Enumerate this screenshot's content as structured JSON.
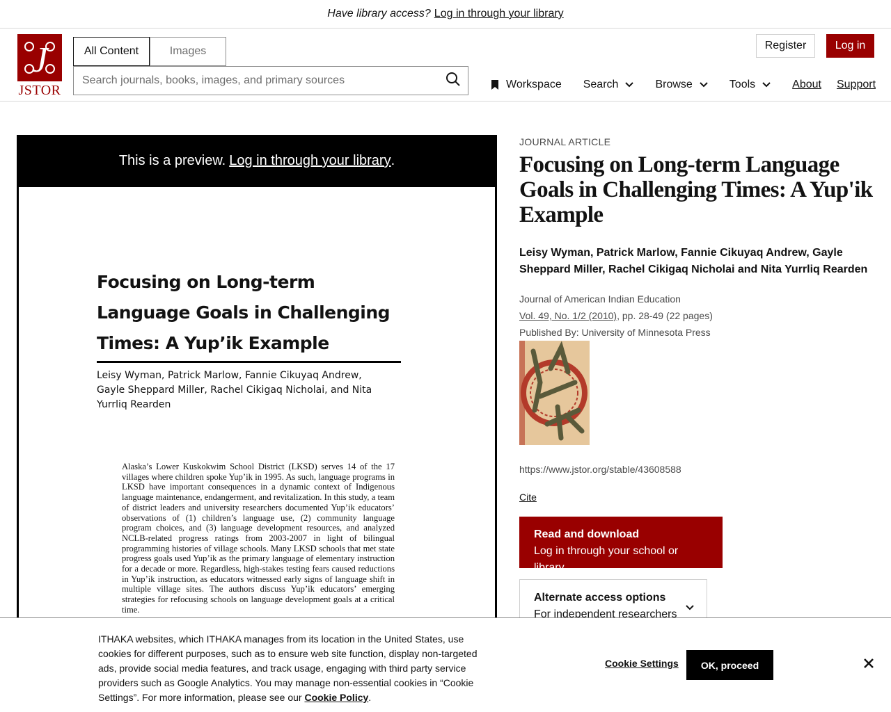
{
  "banner": {
    "question": "Have library access?",
    "link": "Log in through your library"
  },
  "header": {
    "logo_text": "JSTOR",
    "tabs": [
      "All Content",
      "Images"
    ],
    "search_placeholder": "Search journals, books, images, and primary sources",
    "register": "Register",
    "login": "Log in",
    "nav": {
      "workspace": "Workspace",
      "search": "Search",
      "browse": "Browse",
      "tools": "Tools",
      "about": "About",
      "support": "Support"
    }
  },
  "preview": {
    "notice": "This is a preview.",
    "notice_link": "Log in through your library",
    "notice_end": ".",
    "doc_title": "Focusing on Long-term Language Goals in Challenging Times: A Yup’ik Example",
    "doc_authors": "Leisy Wyman, Patrick Marlow, Fannie Cikuyaq Andrew, Gayle Sheppard Miller, Rachel Cikigaq Nicholai, and Nita Yurrliq Rearden",
    "doc_abstract": "Alaska’s Lower Kuskokwim School District (LKSD) serves 14 of the 17 villages where children spoke Yup’ik in 1995. As such, language programs in LKSD have important consequences in a dynamic context of Indigenous language maintenance, endangerment, and revitalization. In this study, a team of district leaders and university researchers documented Yup’ik educators’ observations of (1) children’s language use, (2) community language program choices, and (3) language development resources, and analyzed NCLB-related progress ratings from 2003-2007 in light of bilingual programming histories of village schools. Many LKSD schools that met state progress goals used Yup’ik as the primary language of elementary instruction for a decade or more. Regardless, high-stakes testing fears caused reductions in Yup’ik instruction, as educators witnessed early signs of language shift in multiple village sites. The authors discuss Yup’ik educators’ emerging strategies for refocusing schools on language development goals at a critical time."
  },
  "article": {
    "kind": "Journal Article",
    "title": "Focusing on Long-term Language Goals in Challenging Times: A Yup'ik Example",
    "authors": "Leisy Wyman, Patrick Marlow, Fannie Cikuyaq Andrew, Gayle Sheppard Miller, Rachel Cikigaq Nicholai and Nita Yurrliq Rearden",
    "journal": "Journal of American Indian Education",
    "issue_link": "Vol. 49, No. 1/2 (2010)",
    "pages": ", pp. 28-49 (22 pages)",
    "publisher": "Published By: University of Minnesota Press",
    "url": "https://www.jstor.org/stable/43608588",
    "cite": "Cite",
    "read_title": "Read and download",
    "read_sub": "Log in through your school or library",
    "alt_title": "Alternate access options",
    "alt_sub": "For independent researchers"
  },
  "cookie": {
    "text": "ITHAKA websites, which ITHAKA manages from its location in the United States, use cookies for different purposes, such as to ensure web site function, display non-targeted ads, provide social media features, and track usage, engaging with third party service providers such as Google Analytics. You may manage non-essential cookies in “Cookie Settings”. For more information, please see our ",
    "policy_link": "Cookie Policy",
    "policy_end": ".",
    "settings": "Cookie Settings",
    "ok": "OK, proceed"
  },
  "colors": {
    "brand": "#990000",
    "black": "#000000",
    "text_muted": "#4a4a4a"
  },
  "icons": [
    "search-icon",
    "bookmark-icon",
    "chevron-down-icon",
    "close-icon",
    "jstor-logo"
  ]
}
